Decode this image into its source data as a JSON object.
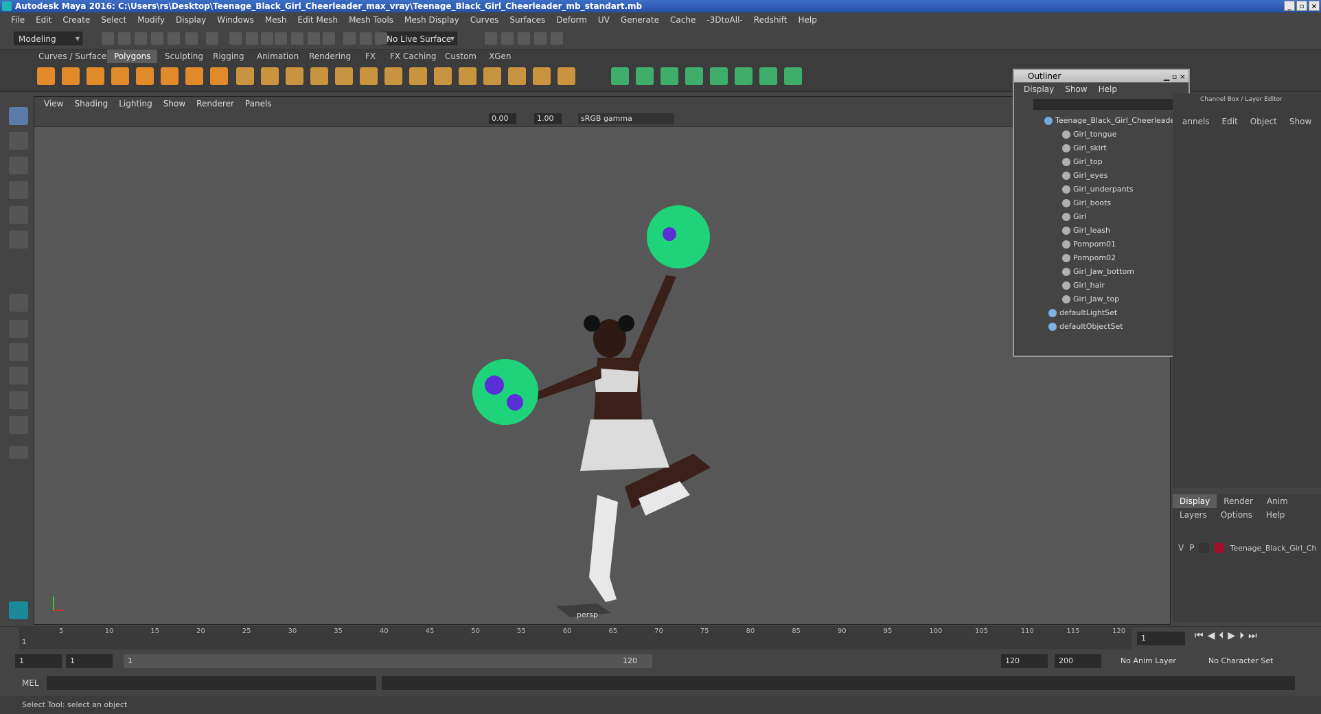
{
  "window": {
    "title": "Autodesk Maya 2016: C:\\Users\\rs\\Desktop\\Teenage_Black_Girl_Cheerleader_max_vray\\Teenage_Black_Girl_Cheerleader_mb_standart.mb"
  },
  "menubar": [
    "File",
    "Edit",
    "Create",
    "Select",
    "Modify",
    "Display",
    "Windows",
    "Mesh",
    "Edit Mesh",
    "Mesh Tools",
    "Mesh Display",
    "Curves",
    "Surfaces",
    "Deform",
    "UV",
    "Generate",
    "Cache",
    "-3DtoAll-",
    "Redshift",
    "Help"
  ],
  "statusline": {
    "mode": "Modeling",
    "live_surface": "No Live Surface"
  },
  "shelf_tabs": [
    "Curves / Surfaces",
    "Polygons",
    "Sculpting",
    "Rigging",
    "Animation",
    "Rendering",
    "FX",
    "FX Caching",
    "Custom",
    "XGen"
  ],
  "shelf_active": "Polygons",
  "viewport": {
    "menu": [
      "View",
      "Shading",
      "Lighting",
      "Show",
      "Renderer",
      "Panels"
    ],
    "exposure": "0.00",
    "gamma": "1.00",
    "colorspace": "sRGB gamma",
    "camera": "persp"
  },
  "outliner": {
    "title": "Outliner",
    "menu": [
      "Display",
      "Show",
      "Help"
    ],
    "root": "Teenage_Black_Girl_Cheerleader_",
    "children": [
      "Girl_tongue",
      "Girl_skirt",
      "Girl_top",
      "Girl_eyes",
      "Girl_underpants",
      "Girl_boots",
      "Girl",
      "Girl_leash",
      "Pompom01",
      "Pompom02",
      "Girl_Jaw_bottom",
      "Girl_hair",
      "Girl_Jaw_top"
    ],
    "sets": [
      "defaultLightSet",
      "defaultObjectSet"
    ]
  },
  "channelbox": {
    "title": "Channel Box / Layer Editor",
    "menu": [
      "annels",
      "Edit",
      "Object",
      "Show"
    ]
  },
  "layer_editor": {
    "tabs": [
      "Display",
      "Render",
      "Anim"
    ],
    "active_tab": "Display",
    "menu": [
      "Layers",
      "Options",
      "Help"
    ],
    "layer": {
      "v": "V",
      "p": "P",
      "name": "Teenage_Black_Girl_Ch",
      "color": "#a0102a"
    }
  },
  "timeline": {
    "ticks": [
      "5",
      "10",
      "15",
      "20",
      "25",
      "30",
      "35",
      "40",
      "45",
      "50",
      "55",
      "60",
      "65",
      "70",
      "75",
      "80",
      "85",
      "90",
      "95",
      "100",
      "105",
      "110",
      "115",
      "120"
    ],
    "start_label": "1",
    "current_frame": "1"
  },
  "range": {
    "start": "1",
    "playback_start": "1",
    "slider_start": "1",
    "slider_end": "120",
    "playback_end": "120",
    "end": "200",
    "anim_layer": "No Anim Layer",
    "char_set": "No Character Set"
  },
  "command": {
    "label": "MEL"
  },
  "help_line": "Select Tool: select an object"
}
